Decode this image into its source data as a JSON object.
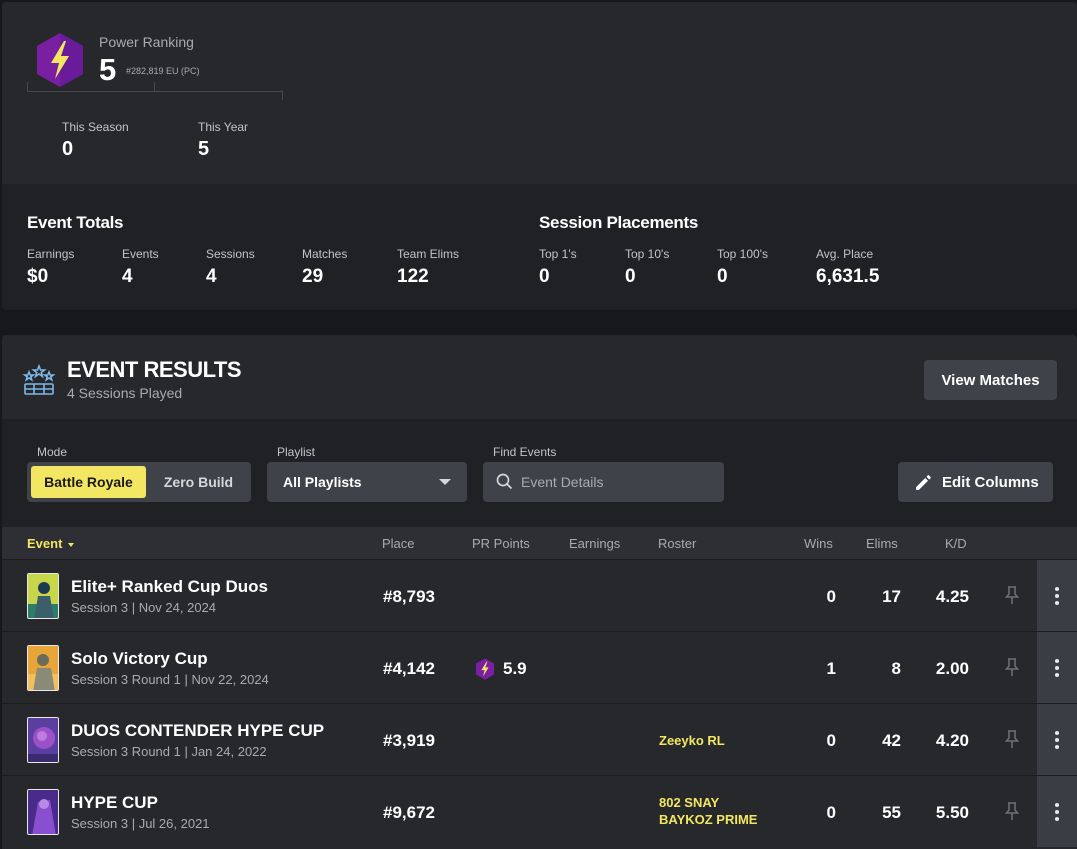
{
  "power_ranking": {
    "label": "Power Ranking",
    "value": "5",
    "sub": "#282,819 EU (PC)",
    "this_season_label": "This Season",
    "this_season_value": "0",
    "this_year_label": "This Year",
    "this_year_value": "5"
  },
  "event_totals": {
    "title": "Event Totals",
    "stats": [
      {
        "label": "Earnings",
        "value": "$0"
      },
      {
        "label": "Events",
        "value": "4"
      },
      {
        "label": "Sessions",
        "value": "4"
      },
      {
        "label": "Matches",
        "value": "29"
      },
      {
        "label": "Team Elims",
        "value": "122"
      }
    ]
  },
  "session_placements": {
    "title": "Session Placements",
    "stats": [
      {
        "label": "Top 1's",
        "value": "0"
      },
      {
        "label": "Top 10's",
        "value": "0"
      },
      {
        "label": "Top 100's",
        "value": "0"
      },
      {
        "label": "Avg. Place",
        "value": "6,631.5"
      }
    ]
  },
  "event_results": {
    "title": "EVENT RESULTS",
    "subtitle": "4 Sessions Played",
    "view_matches_label": "View Matches"
  },
  "filters": {
    "mode_label": "Mode",
    "mode_options": [
      "Battle Royale",
      "Zero Build"
    ],
    "mode_selected": "Battle Royale",
    "playlist_label": "Playlist",
    "playlist_value": "All Playlists",
    "find_label": "Find Events",
    "search_placeholder": "Event Details",
    "edit_columns_label": "Edit Columns"
  },
  "table": {
    "columns": [
      "Event",
      "Place",
      "PR Points",
      "Earnings",
      "Roster",
      "Wins",
      "Elims",
      "K/D"
    ],
    "sorted_column": "Event",
    "rows": [
      {
        "name": "Elite+ Ranked Cup Duos",
        "meta": "Session 3 | Nov 24, 2024",
        "place": "#8,793",
        "pr_points": "",
        "earnings": "",
        "roster": [],
        "wins": "0",
        "elims": "17",
        "kd": "4.25"
      },
      {
        "name": "Solo Victory Cup",
        "meta": "Session 3 Round 1 | Nov 22, 2024",
        "place": "#4,142",
        "pr_points": "5.9",
        "earnings": "",
        "roster": [],
        "wins": "1",
        "elims": "8",
        "kd": "2.00"
      },
      {
        "name": "DUOS CONTENDER HYPE CUP",
        "meta": "Session 3 Round 1 | Jan 24, 2022",
        "place": "#3,919",
        "pr_points": "",
        "earnings": "",
        "roster": [
          "Zeeyko RL"
        ],
        "wins": "0",
        "elims": "42",
        "kd": "4.20"
      },
      {
        "name": "HYPE CUP",
        "meta": "Session 3 | Jul 26, 2021",
        "place": "#9,672",
        "pr_points": "",
        "earnings": "",
        "roster": [
          "802 SNAY",
          "BAYKOZ PRIME"
        ],
        "wins": "0",
        "elims": "55",
        "kd": "5.50"
      }
    ]
  },
  "icons": {
    "power_ranking": "lightning-hexagon-icon",
    "event_results": "trophy-stars-icon",
    "search": "search-icon",
    "edit": "pencil-icon",
    "pin": "pin-icon",
    "more": "more-vertical-icon",
    "dropdown": "chevron-down-icon"
  },
  "colors": {
    "accent_yellow": "#f2e662",
    "hex_purple": "#7b1fa2",
    "bg_card": "#26282c",
    "bg_dark": "#1f2124"
  }
}
